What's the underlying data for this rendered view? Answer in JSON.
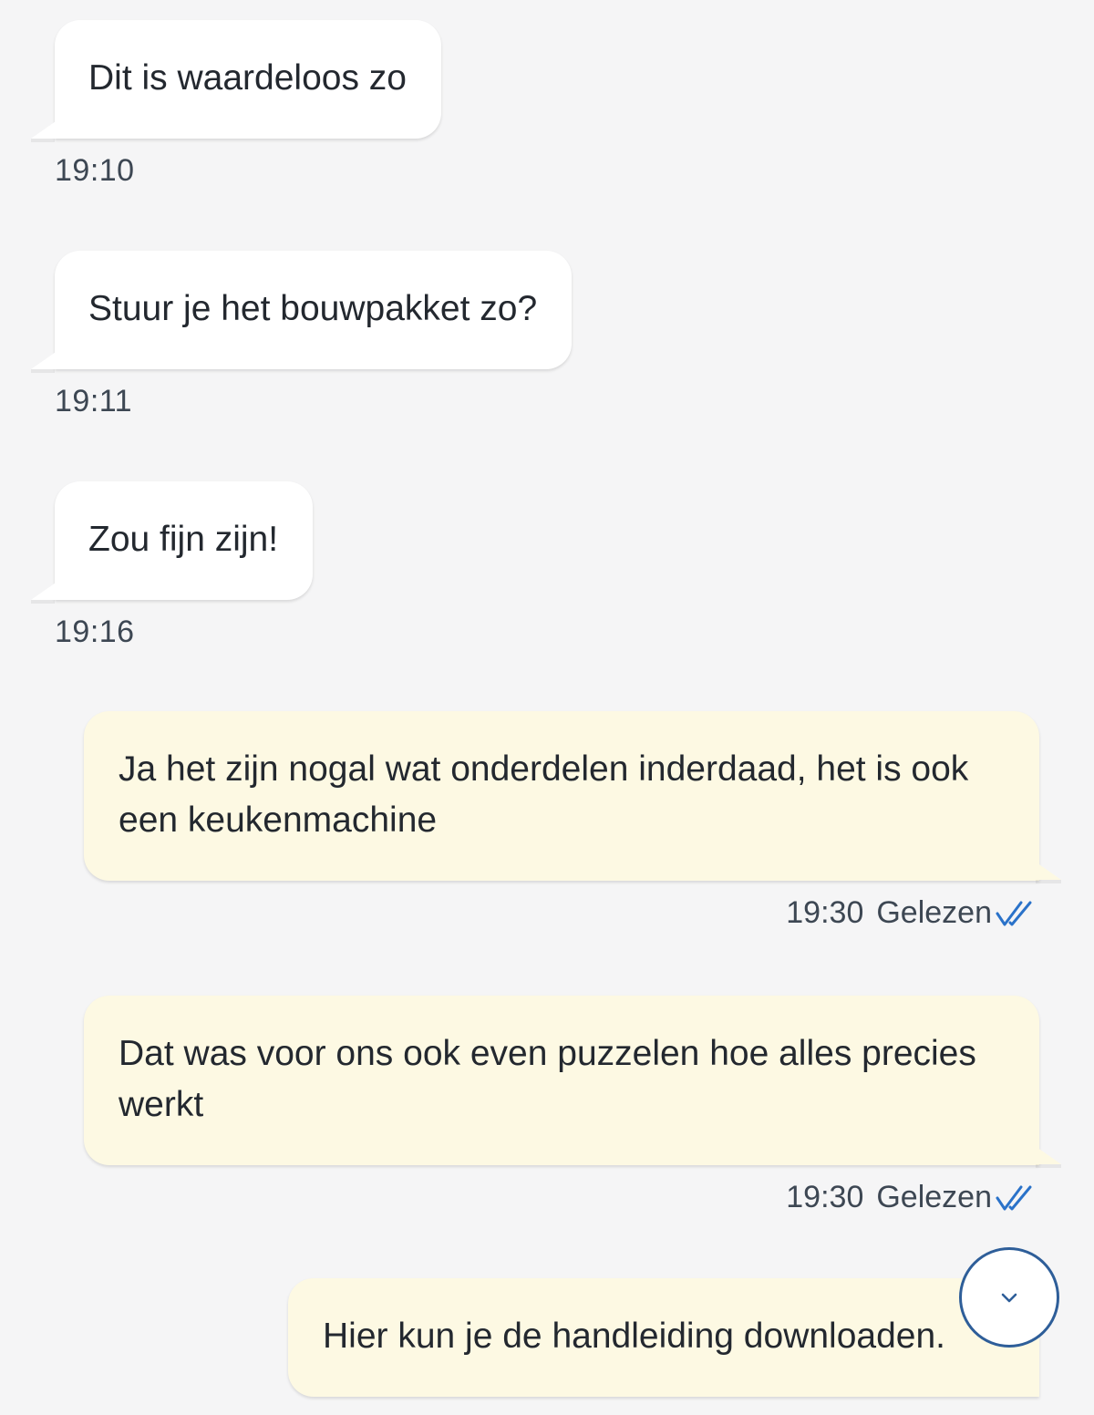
{
  "messages": [
    {
      "direction": "in",
      "text": "Dit is waardeloos zo",
      "time": "19:10"
    },
    {
      "direction": "in",
      "text": "Stuur je het bouwpakket zo?",
      "time": "19:11"
    },
    {
      "direction": "in",
      "text": "Zou fijn zijn!",
      "time": "19:16"
    },
    {
      "direction": "out",
      "text": "Ja het zijn nogal wat onderdelen inderdaad, het is ook een keukenmachine",
      "time": "19:30",
      "status": "Gelezen"
    },
    {
      "direction": "out",
      "text": "Dat was voor ons ook even puzzelen hoe alles precies werkt",
      "time": "19:30",
      "status": "Gelezen"
    },
    {
      "direction": "out",
      "text": "Hier kun je de handleiding downloaden."
    }
  ],
  "icons": {
    "read_receipt": "double-check-icon",
    "scroll_down": "chevron-down-icon"
  },
  "colors": {
    "background": "#f5f5f6",
    "incoming_bubble": "#ffffff",
    "outgoing_bubble": "#fdf9e3",
    "read_tick": "#2a72c9",
    "scroll_button_border": "#2e5e99"
  }
}
